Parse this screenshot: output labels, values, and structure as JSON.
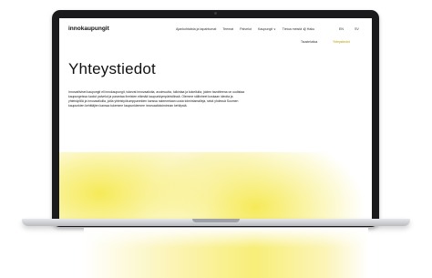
{
  "site": {
    "logo": "innokaupungit",
    "menu": [
      "Ajankohtaista ja tapahtumat",
      "Teemat",
      "Palvelut",
      "Kaupungit ∨",
      "Tietoa meistä ∨"
    ],
    "search": "Q Haku",
    "lang_en": "EN",
    "lang_sv": "SV",
    "subnav": [
      "Tausteluttoa",
      "Yhteystiedot"
    ]
  },
  "page": {
    "title": "Yhteystiedot",
    "intro": "Innovatiiviset kaupungit eli innokaupungit, tukevat innovaatioita, avoimuutta, tulkintaa ja kokeiluita, joiden tavoitteena on uudistaa kaupungeissa luodut palvelut ja parantaa ihmisten elämää kaupunkiympäristöissä. Olemme säilinheet koskaan ideoita ja yhteistyöllä ja innovaatioilla, joilla yhteistyökumppaneiden kanssa rakennetaan uusia toimintamalleja, sekä yhdessä Suomen kaupunkien kehittäjien kanssa tukemme kaupunkiemme innovaatiotoiminnan kehitystä."
  },
  "colors": {
    "accent_yellow": "#f6ea58",
    "bezel": "#1a1a1c"
  }
}
